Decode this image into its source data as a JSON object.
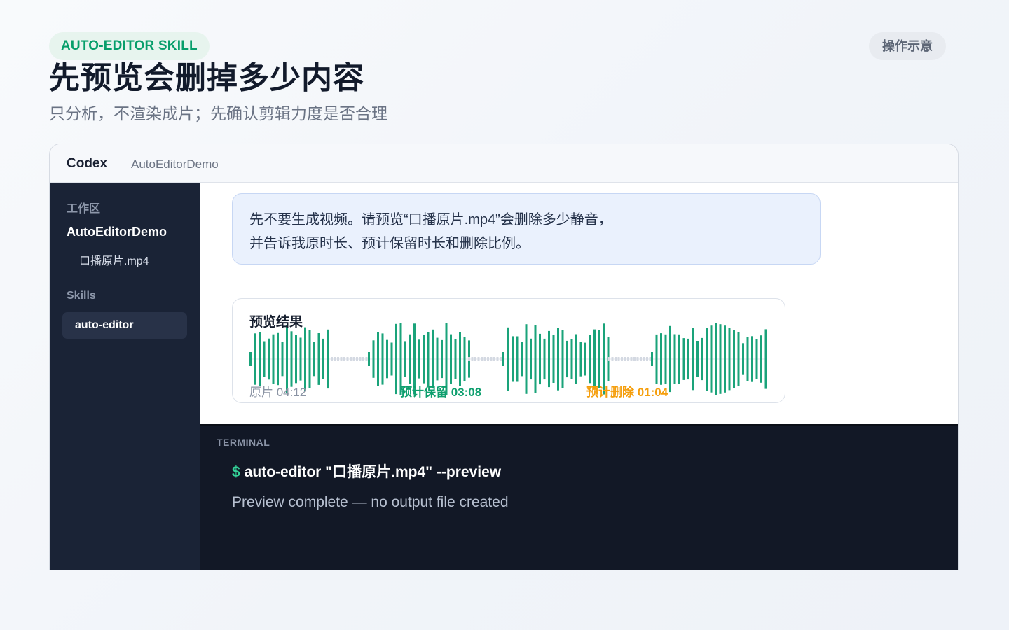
{
  "header": {
    "badge": "AUTO-EDITOR SKILL",
    "demo_label": "操作示意",
    "title": "先预览会删掉多少内容",
    "subtitle": "只分析，不渲染成片；先确认剪辑力度是否合理"
  },
  "window": {
    "app_name": "Codex",
    "project_name": "AutoEditorDemo"
  },
  "sidebar": {
    "workspace_label": "工作区",
    "project": "AutoEditorDemo",
    "file": "口播原片.mp4",
    "skills_label": "Skills",
    "active_skill": "auto-editor"
  },
  "prompt": {
    "line1": "先不要生成视频。请预览“口播原片.mp4”会删除多少静音，",
    "line2": "并告诉我原时长、预计保留时长和删除比例。"
  },
  "result": {
    "title": "预览结果",
    "original": "原片 04:12",
    "kept": "预计保留 03:08",
    "deleted": "预计删除 01:04",
    "colors": {
      "kept": "#1aa37a",
      "removed": "#d4d9e2",
      "deleted_text": "#f59e0b"
    }
  },
  "terminal": {
    "label": "TERMINAL",
    "prompt_symbol": "$",
    "command": "auto-editor \"口播原片.mp4\" --preview",
    "output": "Preview complete — no output file created"
  }
}
